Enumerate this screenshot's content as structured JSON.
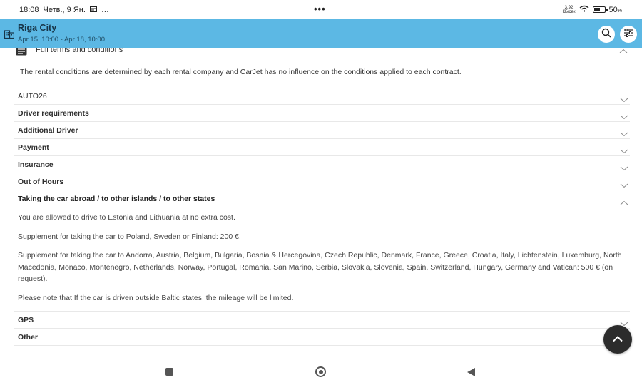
{
  "status_bar": {
    "time": "18:08",
    "date": "Четв., 9 Ян.",
    "extra": "…",
    "center_dots": "•••",
    "net_speed_value": "3,92",
    "net_speed_unit": "КБ/сек",
    "battery": "50",
    "battery_unit": "%"
  },
  "header": {
    "title": "Riga City",
    "subtitle": "Apr 15, 10:00 - Apr 18, 10:00",
    "icons": [
      "building-icon",
      "search-icon",
      "filter-icon"
    ]
  },
  "terms": {
    "title": "Full terms and conditions",
    "intro": "The rental conditions are determined by each rental company and CarJet has no influence on the conditions applied to each contract."
  },
  "sections": [
    {
      "label": "AUTO26",
      "bold": false,
      "expanded": false
    },
    {
      "label": "Driver requirements",
      "bold": false,
      "expanded": false
    },
    {
      "label": "Additional Driver",
      "bold": false,
      "expanded": false
    },
    {
      "label": "Payment",
      "bold": false,
      "expanded": false
    },
    {
      "label": "Insurance",
      "bold": false,
      "expanded": false
    },
    {
      "label": "Out of Hours",
      "bold": false,
      "expanded": false
    }
  ],
  "abroad": {
    "label": "Taking the car abroad / to other islands / to other states",
    "expanded": true,
    "paragraphs": [
      "You are allowed to drive to Estonia and Lithuania at no extra cost.",
      "Supplement for taking the car to Poland, Sweden or Finland: 200 €.",
      "Supplement for taking the car to Andorra, Austria, Belgium, Bulgaria, Bosnia & Hercegovina, Czech Republic, Denmark, France, Greece, Croatia, Italy, Lichtenstein, Luxemburg, North Macedonia, Monaco, Montenegro, Netherlands, Norway, Portugal, Romania, San Marino, Serbia, Slovakia, Slovenia, Spain, Switzerland, Hungary, Germany and Vatican: 500 € (on request).",
      "Please note that If the car is driven outside Baltic states, the mileage will be limited."
    ]
  },
  "sections_after": [
    {
      "label": "GPS"
    },
    {
      "label": "Other"
    }
  ],
  "colors": {
    "header_bg": "#5cb8e4",
    "fab_bg": "#2c2c2c"
  }
}
